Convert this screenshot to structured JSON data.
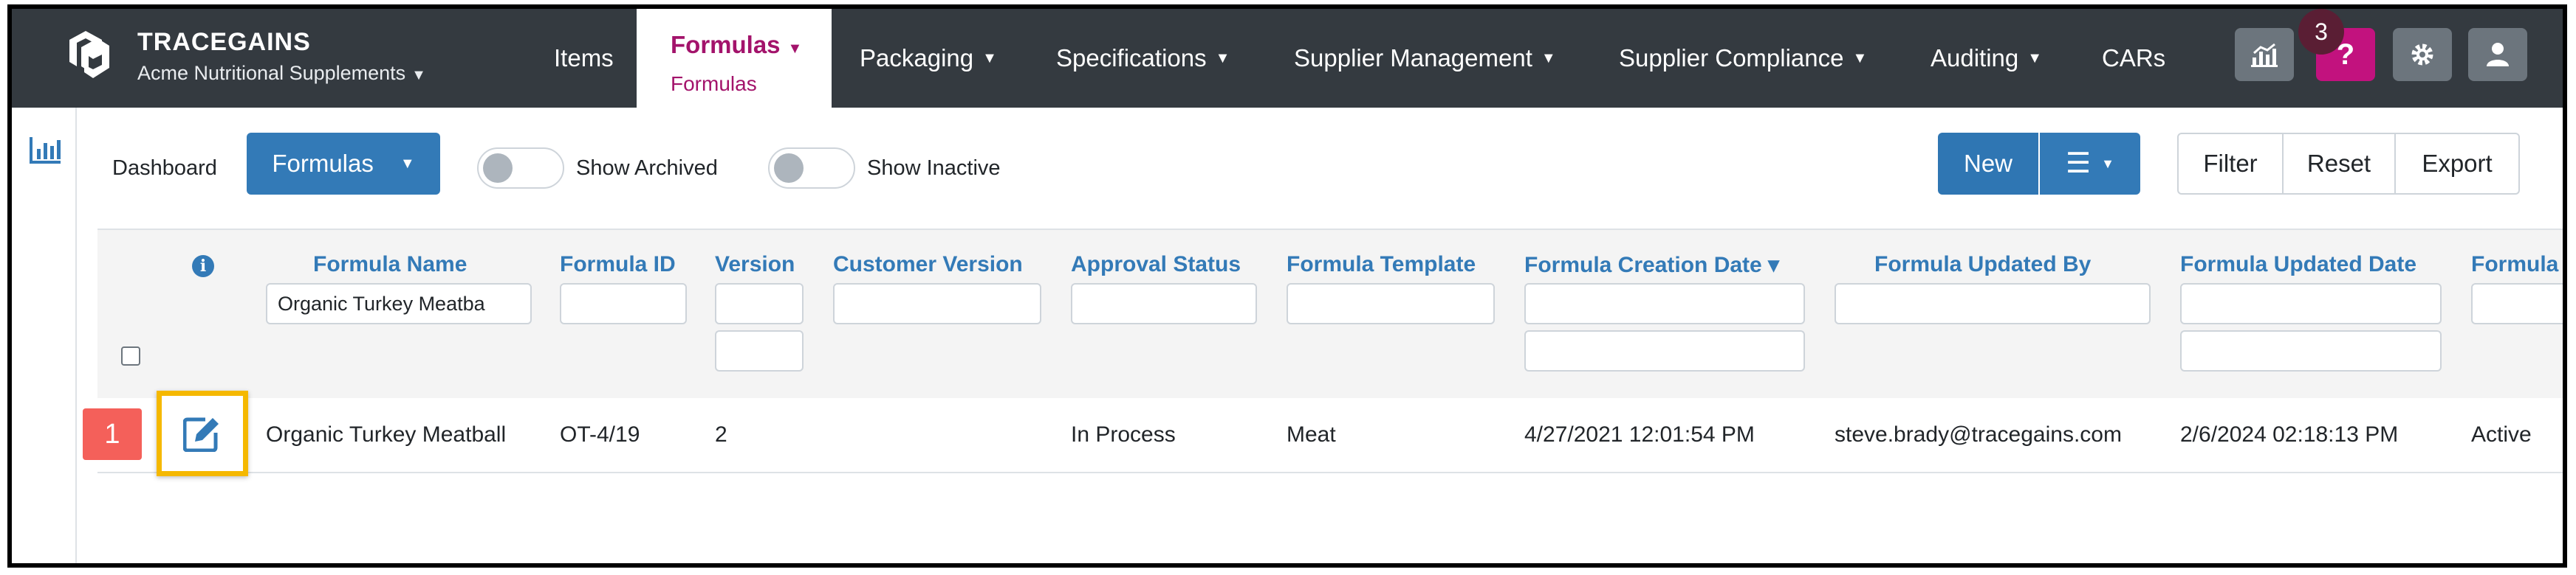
{
  "brand": {
    "name": "TRACEGAINS",
    "account": "Acme Nutritional Supplements"
  },
  "nav": {
    "items": [
      "Items",
      "Packaging",
      "Specifications",
      "Supplier Management",
      "Supplier Compliance",
      "Auditing",
      "CARs"
    ],
    "active": {
      "label": "Formulas",
      "sub": "Formulas"
    },
    "badge_count": "3",
    "help_glyph": "?"
  },
  "toolbar": {
    "dashboard": "Dashboard",
    "view_select": "Formulas",
    "show_archived": "Show Archived",
    "show_inactive": "Show Inactive",
    "new_label": "New",
    "filter": "Filter",
    "reset": "Reset",
    "export": "Export"
  },
  "grid": {
    "columns": [
      "Formula Name",
      "Formula ID",
      "Version",
      "Customer Version",
      "Approval Status",
      "Formula Template",
      "Formula Creation Date ▾",
      "Formula Updated By",
      "Formula Updated Date",
      "Formula A"
    ],
    "filter_name_value": "Organic Turkey Meatba",
    "rows": [
      {
        "cells": [
          "Organic Turkey Meatball",
          "OT-4/19",
          "2",
          "",
          "In Process",
          "Meat",
          "4/27/2021 12:01:54 PM",
          "steve.brady@tracegains.com",
          "2/6/2024 02:18:13 PM",
          "Active"
        ]
      }
    ],
    "step_number": "1"
  },
  "icons": [
    "logo-icon",
    "analytics-icon",
    "help-icon",
    "gear-icon",
    "user-icon",
    "chart-icon",
    "info-icon",
    "hamburger-icon",
    "edit-icon",
    "chevron-down-icon"
  ],
  "colors": {
    "nav_bg": "#343a40",
    "accent_magenta": "#a3136b",
    "primary_blue": "#337ab7",
    "highlight": "#f5b800",
    "step_badge": "#f4605a"
  }
}
